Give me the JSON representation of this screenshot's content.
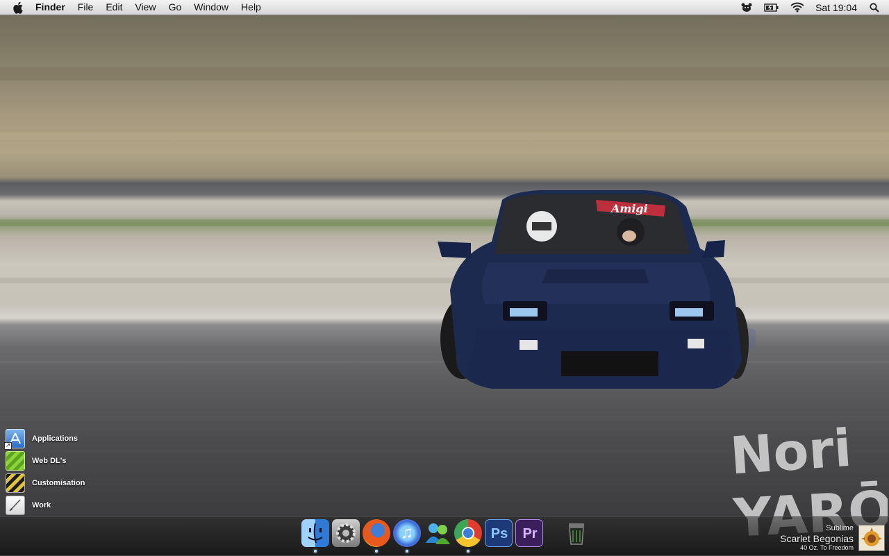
{
  "menubar": {
    "apple_icon": "apple-logo-icon",
    "app_name": "Finder",
    "items": [
      "File",
      "Edit",
      "View",
      "Go",
      "Window",
      "Help"
    ],
    "status_icons": [
      "bear-icon",
      "battery-icon",
      "wifi-icon",
      "spotlight-search-icon"
    ],
    "clock": "Sat 19:04"
  },
  "wallpaper": {
    "windshield_banner": "Amigi",
    "watermark_line1": "Nori",
    "watermark_line2": "YARŌ"
  },
  "desktop_stacks": [
    {
      "label": "Applications",
      "icon": "app-store-folder-icon"
    },
    {
      "label": "Web DL's",
      "icon": "downloads-stack-icon"
    },
    {
      "label": "Customisation",
      "icon": "hazard-stripes-folder-icon"
    },
    {
      "label": "Work",
      "icon": "pen-document-icon"
    }
  ],
  "dock": {
    "items": [
      {
        "name": "Finder",
        "icon": "finder-icon",
        "running": true
      },
      {
        "name": "System Preferences",
        "icon": "system-preferences-gear-icon",
        "running": false
      },
      {
        "name": "Firefox",
        "icon": "firefox-icon",
        "running": true
      },
      {
        "name": "iTunes",
        "icon": "itunes-icon",
        "running": true
      },
      {
        "name": "Messenger",
        "icon": "messenger-buddies-icon",
        "running": false
      },
      {
        "name": "Chrome",
        "icon": "chrome-icon",
        "running": true
      },
      {
        "name": "Photoshop",
        "icon": "photoshop-icon",
        "label": "Ps",
        "running": false
      },
      {
        "name": "Premiere",
        "icon": "premiere-icon",
        "label": "Pr",
        "running": false
      },
      {
        "name": "Trash",
        "icon": "trash-icon",
        "running": false
      }
    ]
  },
  "now_playing": {
    "artist": "Sublime",
    "track": "Scarlet Begonias",
    "album": "40 Oz. To Freedom"
  },
  "colors": {
    "menubar_top": "#f4f4f4",
    "menubar_bottom": "#d6d6d6",
    "car_body": "#1d2a4f",
    "photoshop": "#1c3a78",
    "premiere": "#3a1f5c"
  }
}
